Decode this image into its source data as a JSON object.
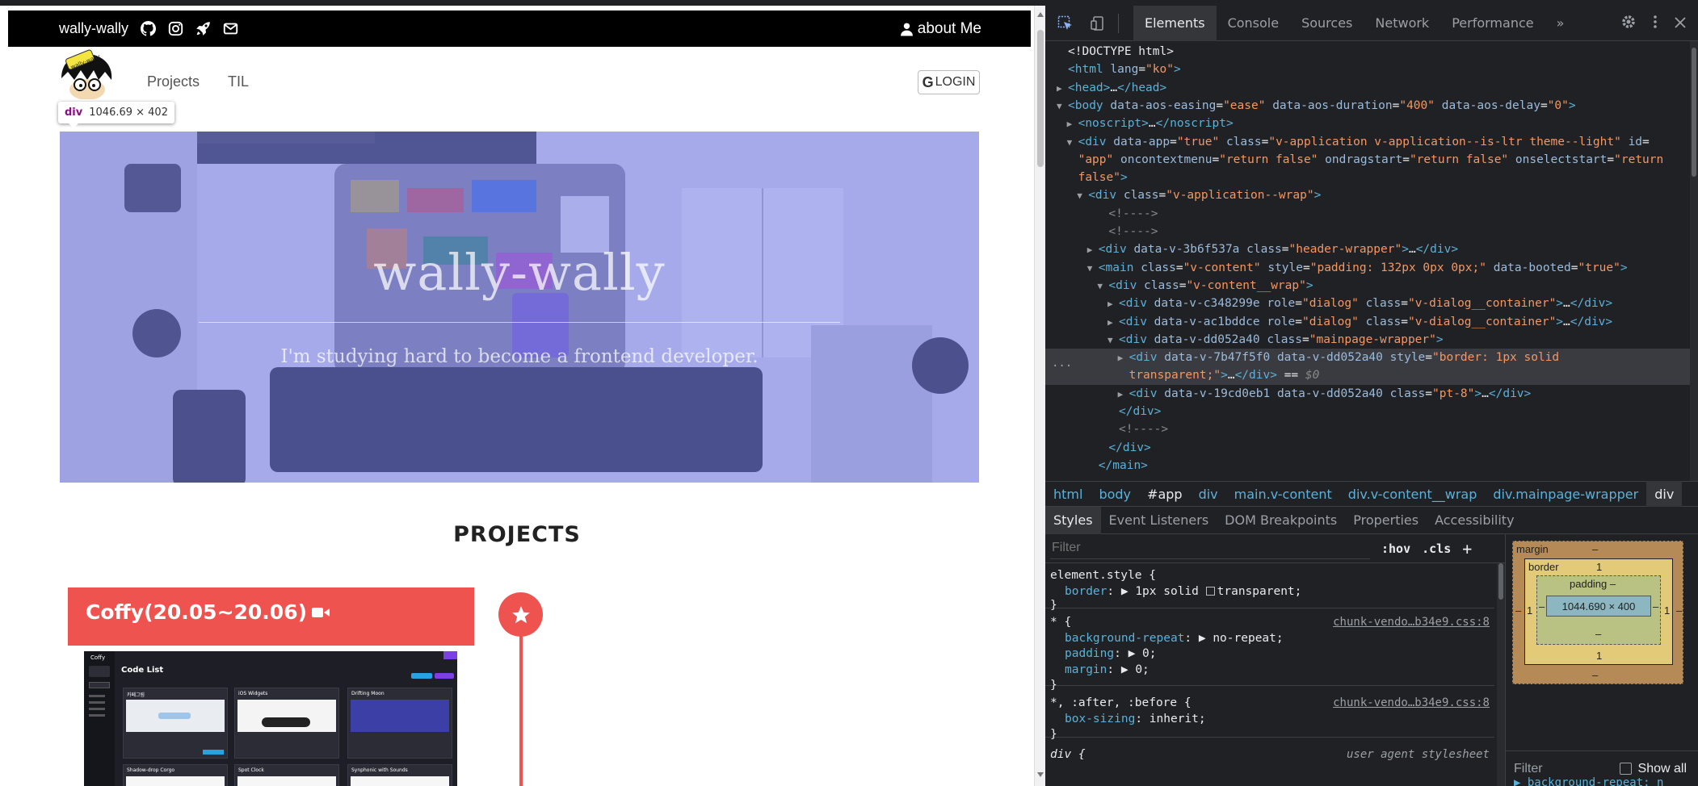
{
  "site": {
    "brand": "wally-wally",
    "about": "about Me",
    "nav": [
      "Projects",
      "TIL"
    ],
    "login_label": "LOGIN",
    "login_glyph": "G",
    "logo_text": "wally-wally",
    "inspect_tooltip": {
      "tag": "div",
      "size": "1046.69 × 402"
    },
    "hero": {
      "title": "wally-wally",
      "subtitle": "I'm studying hard to become a frontend developer."
    },
    "projects_heading": "PROJECTS",
    "project": {
      "title": "Coffy(20.05~20.06)",
      "screenshot": {
        "app_name": "Coffy",
        "heading": "Code List",
        "cards": [
          "카페그림",
          "iOS Widgets",
          "Drifting Moon",
          "Shadow-drop Corgo",
          "Spot Clock",
          "Synphonic with Sounds"
        ]
      }
    }
  },
  "devtools": {
    "tabs": [
      "Elements",
      "Console",
      "Sources",
      "Network",
      "Performance"
    ],
    "more": "»",
    "dom_lines": [
      {
        "indent": 0,
        "arrow": "",
        "html": "<span class='tx'>&lt;!DOCTYPE html&gt;</span>"
      },
      {
        "indent": 0,
        "arrow": "",
        "html": "<span class='tg'>&lt;html</span> <span class='at'>lang</span><span class='tx'>=</span><span class='av'>\"ko\"</span><span class='tg'>&gt;</span>"
      },
      {
        "indent": 0,
        "arrow": "▶",
        "html": "<span class='tg'>&lt;head&gt;</span><span class='tx'>…</span><span class='tg'>&lt;/head&gt;</span>"
      },
      {
        "indent": 0,
        "arrow": "▼",
        "html": "<span class='tg'>&lt;body</span> <span class='at'>data-aos-easing</span><span class='tx'>=</span><span class='av'>\"ease\"</span> <span class='at'>data-aos-duration</span><span class='tx'>=</span><span class='av'>\"400\"</span> <span class='at'>data-aos-delay</span><span class='tx'>=</span><span class='av'>\"0\"</span><span class='tg'>&gt;</span>"
      },
      {
        "indent": 1,
        "arrow": "▶",
        "html": "<span class='tg'>&lt;noscript&gt;</span><span class='tx'>…</span><span class='tg'>&lt;/noscript&gt;</span>"
      },
      {
        "indent": 1,
        "arrow": "▼",
        "html": "<span class='tg'>&lt;div</span> <span class='at'>data-app</span><span class='tx'>=</span><span class='av'>\"true\"</span> <span class='at'>class</span><span class='tx'>=</span><span class='av'>\"v-application v-application--is-ltr theme--light\"</span> <span class='at'>id</span><span class='tx'>=</span>"
      },
      {
        "indent": 1,
        "arrow": "",
        "html": "<span class='av'>\"app\"</span> <span class='at'>oncontextmenu</span><span class='tx'>=</span><span class='av'>\"return false\"</span> <span class='at'>ondragstart</span><span class='tx'>=</span><span class='av'>\"return false\"</span> <span class='at'>onselectstart</span><span class='tx'>=</span><span class='av'>\"return</span>"
      },
      {
        "indent": 1,
        "arrow": "",
        "html": "<span class='av'>false\"</span><span class='tg'>&gt;</span>"
      },
      {
        "indent": 2,
        "arrow": "▼",
        "html": "<span class='tg'>&lt;div</span> <span class='at'>class</span><span class='tx'>=</span><span class='av'>\"v-application--wrap\"</span><span class='tg'>&gt;</span>"
      },
      {
        "indent": 4,
        "arrow": "",
        "html": "<span class='cm'>&lt;!----&gt;</span>"
      },
      {
        "indent": 4,
        "arrow": "",
        "html": "<span class='cm'>&lt;!----&gt;</span>"
      },
      {
        "indent": 3,
        "arrow": "▶",
        "html": "<span class='tg'>&lt;div</span> <span class='at'>data-v-3b6f537a</span> <span class='at'>class</span><span class='tx'>=</span><span class='av'>\"header-wrapper\"</span><span class='tg'>&gt;</span><span class='tx'>…</span><span class='tg'>&lt;/div&gt;</span>"
      },
      {
        "indent": 3,
        "arrow": "▼",
        "html": "<span class='tg'>&lt;main</span> <span class='at'>class</span><span class='tx'>=</span><span class='av'>\"v-content\"</span> <span class='at'>style</span><span class='tx'>=</span><span class='av'>\"padding: 132px 0px 0px;\"</span> <span class='at'>data-booted</span><span class='tx'>=</span><span class='av'>\"true\"</span><span class='tg'>&gt;</span>"
      },
      {
        "indent": 4,
        "arrow": "▼",
        "html": "<span class='tg'>&lt;div</span> <span class='at'>class</span><span class='tx'>=</span><span class='av'>\"v-content__wrap\"</span><span class='tg'>&gt;</span>"
      },
      {
        "indent": 5,
        "arrow": "▶",
        "html": "<span class='tg'>&lt;div</span> <span class='at'>data-v-c348299e</span> <span class='at'>role</span><span class='tx'>=</span><span class='av'>\"dialog\"</span> <span class='at'>class</span><span class='tx'>=</span><span class='av'>\"v-dialog__container\"</span><span class='tg'>&gt;</span><span class='tx'>…</span><span class='tg'>&lt;/div&gt;</span>"
      },
      {
        "indent": 5,
        "arrow": "▶",
        "html": "<span class='tg'>&lt;div</span> <span class='at'>data-v-ac1bddce</span> <span class='at'>role</span><span class='tx'>=</span><span class='av'>\"dialog\"</span> <span class='at'>class</span><span class='tx'>=</span><span class='av'>\"v-dialog__container\"</span><span class='tg'>&gt;</span><span class='tx'>…</span><span class='tg'>&lt;/div&gt;</span>"
      },
      {
        "indent": 5,
        "arrow": "▼",
        "html": "<span class='tg'>&lt;div</span> <span class='at'>data-v-dd052a40</span> <span class='at'>class</span><span class='tx'>=</span><span class='av'>\"mainpage-wrapper\"</span><span class='tg'>&gt;</span>"
      },
      {
        "indent": 6,
        "arrow": "▶",
        "selected": true,
        "html": "<span class='tg'>&lt;div</span> <span class='at'>data-v-7b47f5f0</span> <span class='at'>data-v-dd052a40</span> <span class='at'>style</span><span class='tx'>=</span><span class='av'>\"border: 1px solid</span>"
      },
      {
        "indent": 6,
        "arrow": "",
        "selected": true,
        "html": "<span class='av'>transparent;\"</span><span class='tg'>&gt;</span><span class='tx'>…</span><span class='tg'>&lt;/div&gt;</span> <span class='tx'>== </span><span class='cm'><i>$0</i></span>"
      },
      {
        "indent": 6,
        "arrow": "▶",
        "html": "<span class='tg'>&lt;div</span> <span class='at'>data-v-19cd0eb1</span> <span class='at'>data-v-dd052a40</span> <span class='at'>class</span><span class='tx'>=</span><span class='av'>\"pt-8\"</span><span class='tg'>&gt;</span><span class='tx'>…</span><span class='tg'>&lt;/div&gt;</span>"
      },
      {
        "indent": 5,
        "arrow": "",
        "html": "<span class='tg'>&lt;/div&gt;</span>"
      },
      {
        "indent": 5,
        "arrow": "",
        "html": "<span class='cm'>&lt;!----&gt;</span>"
      },
      {
        "indent": 4,
        "arrow": "",
        "html": "<span class='tg'>&lt;/div&gt;</span>"
      },
      {
        "indent": 3,
        "arrow": "",
        "html": "<span class='tg'>&lt;/main&gt;</span>"
      }
    ],
    "dots": "···",
    "breadcrumbs": [
      {
        "label": "html",
        "kind": "tag"
      },
      {
        "label": "body",
        "kind": "tag"
      },
      {
        "label": "#app",
        "kind": "dim"
      },
      {
        "label": "div",
        "kind": "tag"
      },
      {
        "label": "main.v-content",
        "kind": "tag"
      },
      {
        "label": "div.v-content__wrap",
        "kind": "tag"
      },
      {
        "label": "div.mainpage-wrapper",
        "kind": "tag"
      },
      {
        "label": "div",
        "kind": "active"
      }
    ],
    "sub_tabs": [
      "Styles",
      "Event Listeners",
      "DOM Breakpoints",
      "Properties",
      "Accessibility"
    ],
    "styles": {
      "filter_placeholder": "Filter",
      "hov": ":hov",
      "cls": ".cls",
      "plus": "+",
      "element_style": {
        "selector": "element.style {",
        "prop": "border",
        "value": "1px solid",
        "value2": "transparent;"
      },
      "rule1": {
        "selector": "* {",
        "source": "chunk-vendo…b34e9.css:8",
        "props": [
          [
            "background-repeat",
            "no-repeat;"
          ],
          [
            "padding",
            "0;"
          ],
          [
            "margin",
            "0;"
          ]
        ]
      },
      "rule2": {
        "selector": "*, :after, :before {",
        "source": "chunk-vendo…b34e9.css:8",
        "props": [
          [
            "box-sizing",
            "inherit;"
          ]
        ]
      },
      "rule3": {
        "selector": "div {",
        "source": "user agent stylesheet"
      },
      "close_brace": "}"
    },
    "box_model": {
      "margin_label": "margin",
      "margin_dash": "–",
      "border_label": "border",
      "border_value": "1",
      "padding_label": "padding –",
      "content": "1044.690 × 400",
      "side_value": "1",
      "dash": "–",
      "filter_label": "Filter",
      "show_all": "Show all",
      "bottom_text": "▶ background-repeat: n"
    }
  }
}
